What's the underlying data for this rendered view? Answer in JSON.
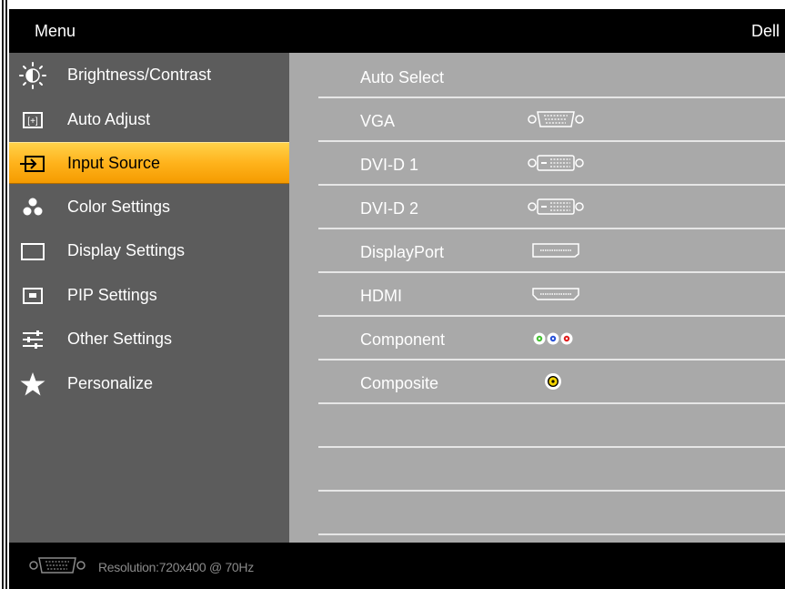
{
  "header": {
    "title": "Menu",
    "brand": "Dell"
  },
  "menu": {
    "selected_index": 2,
    "items": [
      {
        "label": "Brightness/Contrast",
        "icon": "brightness-icon"
      },
      {
        "label": "Auto Adjust",
        "icon": "auto-adjust-icon"
      },
      {
        "label": "Input Source",
        "icon": "input-source-icon"
      },
      {
        "label": "Color Settings",
        "icon": "color-settings-icon"
      },
      {
        "label": "Display Settings",
        "icon": "display-settings-icon"
      },
      {
        "label": "PIP Settings",
        "icon": "pip-settings-icon"
      },
      {
        "label": "Other Settings",
        "icon": "other-settings-icon"
      },
      {
        "label": "Personalize",
        "icon": "star-icon"
      }
    ]
  },
  "inputs": {
    "items": [
      {
        "label": "Auto Select",
        "icon": ""
      },
      {
        "label": "VGA",
        "icon": "vga-connector-icon"
      },
      {
        "label": "DVI-D 1",
        "icon": "dvi-connector-icon"
      },
      {
        "label": "DVI-D 2",
        "icon": "dvi-connector-icon"
      },
      {
        "label": "DisplayPort",
        "icon": "displayport-connector-icon"
      },
      {
        "label": "HDMI",
        "icon": "hdmi-connector-icon"
      },
      {
        "label": "Component",
        "icon": "component-rca-icon"
      },
      {
        "label": "Composite",
        "icon": "composite-rca-icon"
      },
      {
        "label": "",
        "icon": ""
      },
      {
        "label": "",
        "icon": ""
      },
      {
        "label": "",
        "icon": ""
      }
    ]
  },
  "footer": {
    "icon": "vga-connector-icon",
    "resolution_text": "Resolution:720x400 @ 70Hz"
  },
  "colors": {
    "selected_highlight": "#ffb31c",
    "left_panel": "#5c5c5c",
    "right_panel": "#a9a9a9",
    "header_bg": "#000000"
  }
}
